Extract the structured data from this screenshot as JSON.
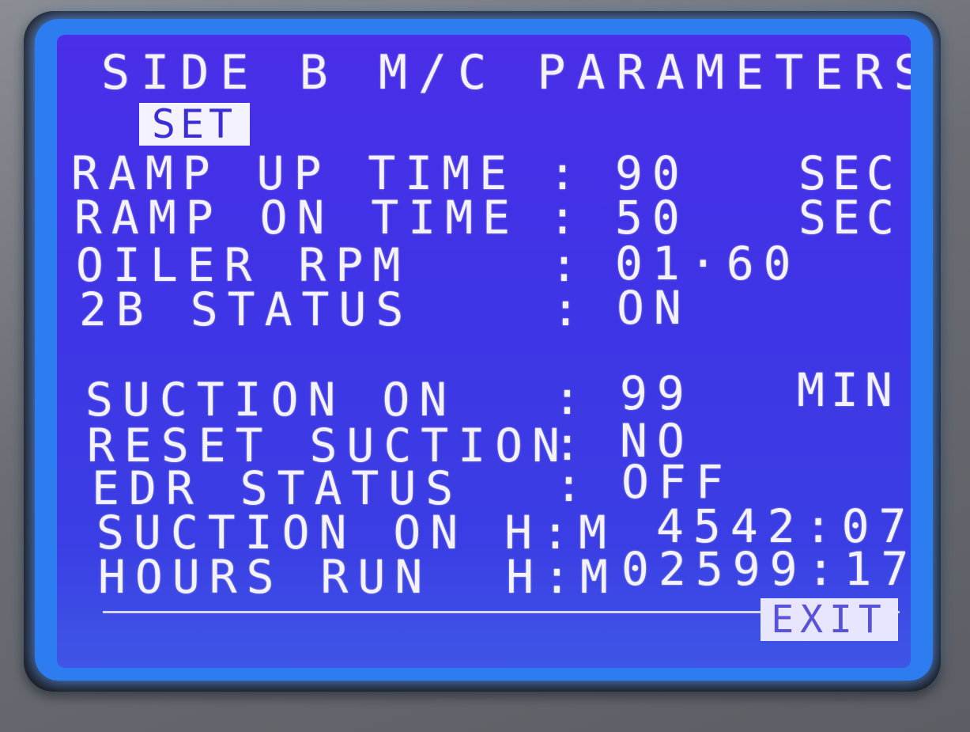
{
  "screen": {
    "title": "SIDE B M/C PARAMETERS",
    "set_label": "SET",
    "exit_label": "EXIT",
    "separator": ":",
    "parameters": [
      {
        "label": "RAMP UP TIME",
        "value": "90",
        "unit": "SEC"
      },
      {
        "label": "RAMP ON TIME",
        "value": "50",
        "unit": "SEC"
      },
      {
        "label": "OILER RPM",
        "value": "01·60",
        "unit": ""
      },
      {
        "label": "2B STATUS",
        "value": "ON",
        "unit": ""
      },
      {
        "label": "SUCTION ON",
        "value": "99",
        "unit": "MIN"
      },
      {
        "label": "RESET SUCTION",
        "value": "NO",
        "unit": ""
      },
      {
        "label": "EDR STATUS",
        "value": "OFF",
        "unit": ""
      }
    ],
    "counters": [
      {
        "label": "SUCTION ON H:M",
        "value": "4542:07"
      },
      {
        "label": "HOURS RUN  H:M",
        "value": "02599:17"
      }
    ]
  },
  "colors": {
    "screen_bg": "#4a2ee8",
    "text": "#f4f2ff",
    "backlight": "#2e7df0"
  }
}
